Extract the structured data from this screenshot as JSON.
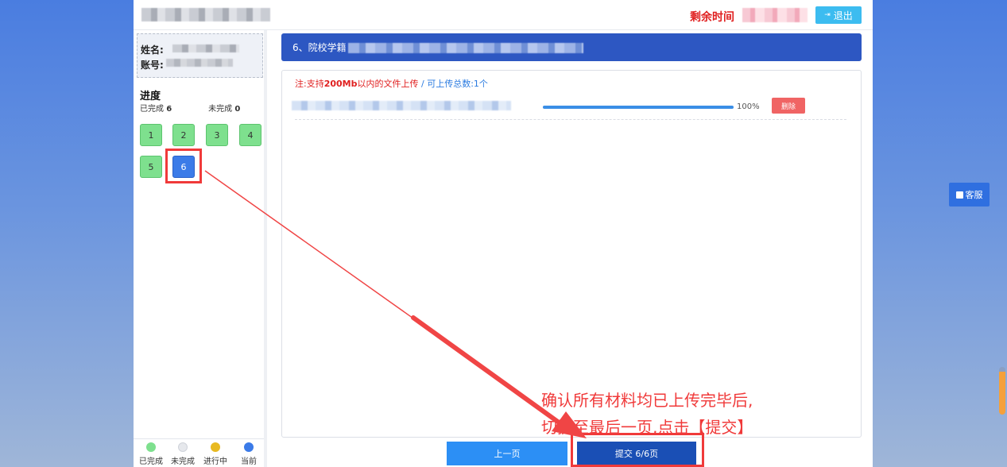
{
  "header": {
    "timer_label": "剩余时间",
    "logout_icon": "logout-icon",
    "logout_label": "退出"
  },
  "sidebar": {
    "name_label": "姓名:",
    "account_label": "账号:",
    "progress_title": "进度",
    "completed_label": "已完成",
    "completed_count": "6",
    "incomplete_label": "未完成",
    "incomplete_count": "0",
    "questions": [
      "1",
      "2",
      "3",
      "4",
      "5",
      "6"
    ],
    "current_question": "6",
    "legend": [
      {
        "label": "已完成",
        "color": "#7ee08e"
      },
      {
        "label": "未完成",
        "color": "#e6e8ec"
      },
      {
        "label": "进行中",
        "color": "#e8b921"
      },
      {
        "label": "当前",
        "color": "#3b7be8"
      }
    ]
  },
  "main": {
    "question_title": "6、院校学籍",
    "note_prefix": "注:支持",
    "note_size": "200Mb",
    "note_suffix": "以内的文件上传",
    "note_count": "/ 可上传总数:1个",
    "upload_progress": "100%",
    "upload_progress_value": 1.0,
    "delete_label": "删除",
    "prev_label": "上一页",
    "submit_label": "提交 6/6页"
  },
  "annotation": {
    "line1": "确认所有材料均已上传完毕后,",
    "line2": "切换至最后一页,点击【提交】"
  },
  "floating": {
    "service_label": "客服",
    "service_icon": "chat-icon"
  },
  "colors": {
    "accent": "#2d57c2",
    "highlight_red": "#f03a3a",
    "logout": "#3cbcf0"
  }
}
